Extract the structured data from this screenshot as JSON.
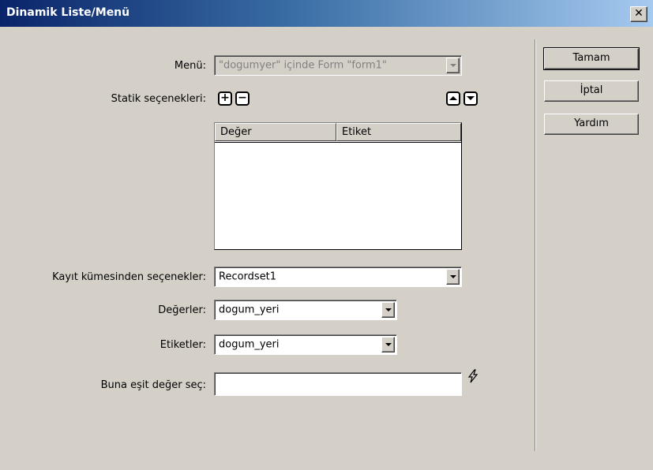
{
  "window": {
    "title": "Dinamik Liste/Menü",
    "close_glyph": "✕"
  },
  "form": {
    "menu_label": "Menü:",
    "menu_value": "\"dogumyer\" içinde Form \"form1\"",
    "static_options_label": "Statik seçenekleri:",
    "add_glyph": "+",
    "remove_glyph": "−",
    "list_columns": [
      "Değer",
      "Etiket"
    ],
    "recordset_label": "Kayıt kümesinden seçenekler:",
    "recordset_value": "Recordset1",
    "values_label": "Değerler:",
    "values_value": "dogum_yeri",
    "labels_label": "Etiketler:",
    "labels_value": "dogum_yeri",
    "select_equal_label": "Buna eşit değer seç:",
    "select_equal_value": ""
  },
  "buttons": {
    "ok": "Tamam",
    "cancel": "İptal",
    "help": "Yardım"
  },
  "icons": {
    "add": "plus-icon",
    "remove": "minus-icon",
    "move_up": "arrow-up-icon",
    "move_down": "arrow-down-icon",
    "dynamic_data": "lightning-icon"
  }
}
